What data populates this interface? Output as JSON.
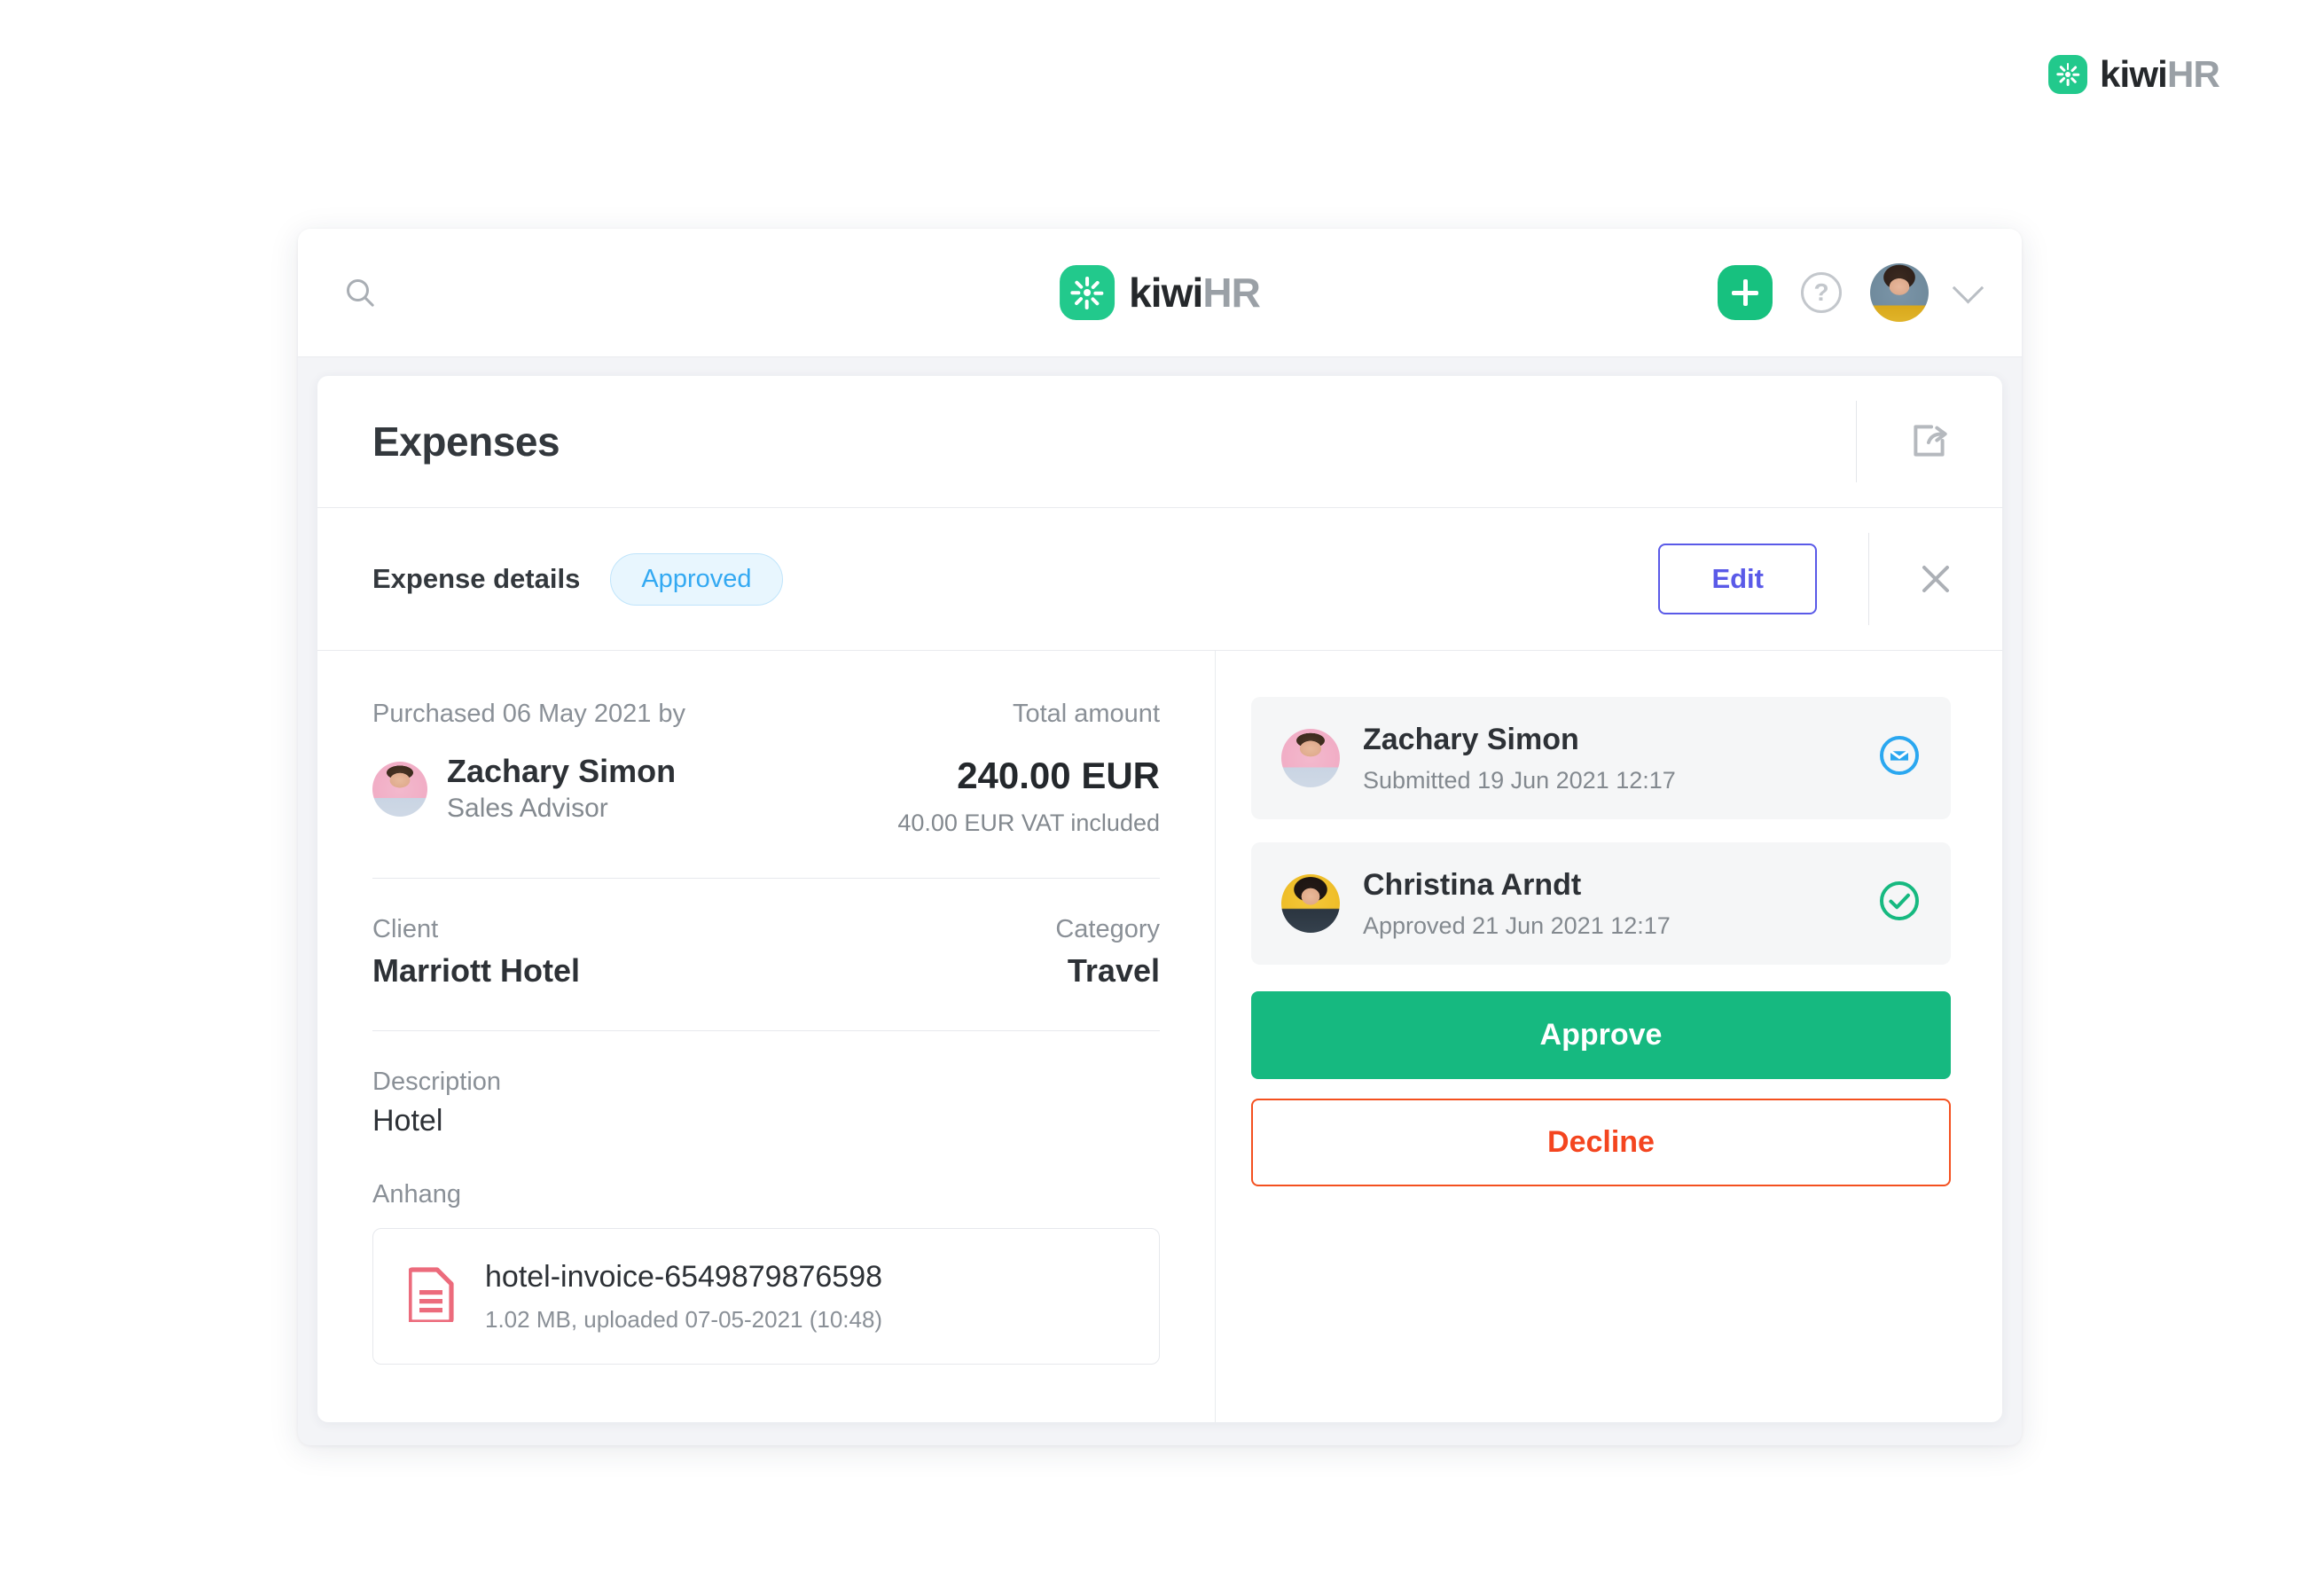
{
  "brand": {
    "name_primary": "kiwi",
    "name_secondary": "HR",
    "accent_green": "#22c98c"
  },
  "topbar": {
    "search_icon": "search-icon",
    "add_icon": "plus-icon",
    "help_icon": "question-mark-icon",
    "avatar_alt": "user-avatar",
    "chevron_icon": "chevron-down-icon"
  },
  "page": {
    "title": "Expenses",
    "export_icon": "export-share-icon"
  },
  "detail_header": {
    "title": "Expense details",
    "status_badge": "Approved",
    "status_color": "#33a9f2",
    "edit_label": "Edit",
    "close_icon": "close-x-icon"
  },
  "expense": {
    "purchased_label": "Purchased 06 May 2021 by",
    "purchaser_name": "Zachary Simon",
    "purchaser_role": "Sales Advisor",
    "total_label": "Total amount",
    "total_value": "240.00 EUR",
    "vat_note": "40.00 EUR VAT included",
    "client_label": "Client",
    "client_value": "Marriott Hotel",
    "category_label": "Category",
    "category_value": "Travel",
    "description_label": "Description",
    "description_value": "Hotel",
    "attachment_label": "Anhang",
    "attachment_name": "hotel-invoice-6549879876598",
    "attachment_meta": "1.02 MB, uploaded 07-05-2021 (10:48)",
    "attachment_icon": "document-file-icon"
  },
  "approvals": [
    {
      "name": "Zachary Simon",
      "status_text": "Submitted 19 Jun 2021 12:17",
      "status_icon": "envelope-circle-icon",
      "status_color": "#2aa7f0",
      "avatar_class": "face-zach"
    },
    {
      "name": "Christina Arndt",
      "status_text": "Approved 21 Jun 2021 12:17",
      "status_icon": "check-circle-icon",
      "status_color": "#16b980",
      "avatar_class": "face-christina"
    }
  ],
  "actions": {
    "approve_label": "Approve",
    "approve_color": "#16b980",
    "decline_label": "Decline",
    "decline_color": "#f4501f"
  }
}
